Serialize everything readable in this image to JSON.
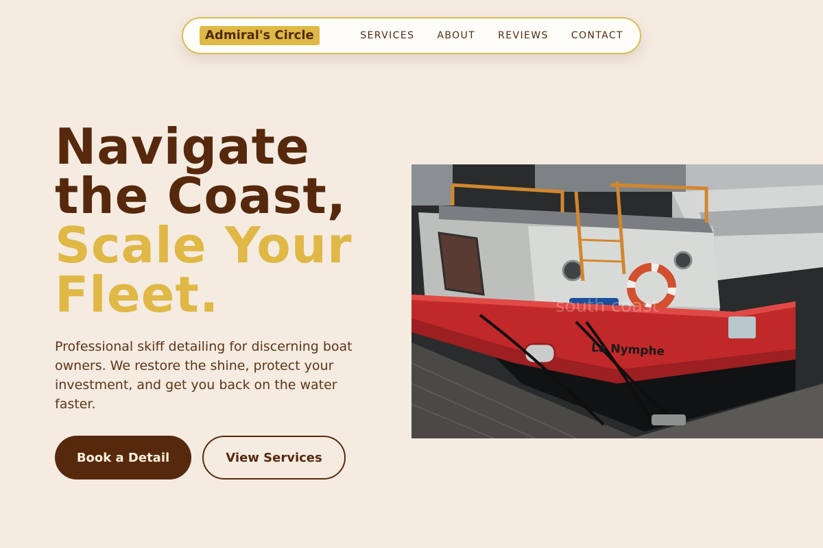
{
  "nav": {
    "brand": "Admiral's Circle",
    "links": [
      "SERVICES",
      "ABOUT",
      "REVIEWS",
      "CONTACT"
    ]
  },
  "hero": {
    "headline_line1": "Navigate",
    "headline_line2": "the Coast,",
    "headline_line3": "Scale Your",
    "headline_line4": "Fleet.",
    "subtext": "Professional skiff detailing for discerning boat owners. We restore the shine, protect your investment, and get you back on the water faster.",
    "primary_button": "Book a Detail",
    "secondary_button": "View Services",
    "image": {
      "boat_name": "La Nymphe",
      "watermark": "south coast"
    }
  },
  "colors": {
    "background": "#f5ebe1",
    "brown": "#56290d",
    "gold": "#dfb846",
    "hull_red": "#c0282a"
  }
}
